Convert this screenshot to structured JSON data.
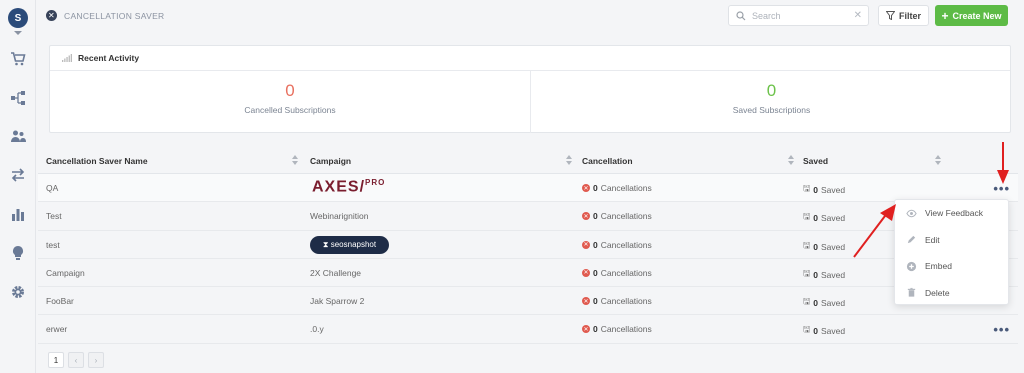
{
  "header": {
    "app_title": "CANCELLATION SAVER",
    "search_placeholder": "Search",
    "filter_label": "Filter",
    "create_label": "Create New"
  },
  "sidebar": {
    "logo_text": "S",
    "items": [
      "cart-icon",
      "flow-icon",
      "users-icon",
      "transfer-icon",
      "chart-icon",
      "bulb-icon",
      "gear-icon"
    ]
  },
  "recent_activity": {
    "title": "Recent Activity",
    "cancelled": {
      "value": "0",
      "label": "Cancelled Subscriptions",
      "color": "#e8705f"
    },
    "saved": {
      "value": "0",
      "label": "Saved Subscriptions",
      "color": "#6cc24a"
    }
  },
  "table": {
    "columns": [
      "Cancellation Saver Name",
      "Campaign",
      "Cancellation",
      "Saved"
    ],
    "rows": [
      {
        "name": "QA",
        "campaign": "",
        "campaign_logo": "AXES/PRO",
        "cancel_count": "0",
        "cancel_label": "Cancellations",
        "saved_count": "0",
        "saved_label": "Saved"
      },
      {
        "name": "Test",
        "campaign": "Webinarignition",
        "cancel_count": "0",
        "cancel_label": "Cancellations",
        "saved_count": "0",
        "saved_label": "Saved"
      },
      {
        "name": "test",
        "campaign": "",
        "campaign_logo": "seosnapshot",
        "cancel_count": "0",
        "cancel_label": "Cancellations",
        "saved_count": "0",
        "saved_label": "Saved"
      },
      {
        "name": "Campaign",
        "campaign": "2X Challenge",
        "cancel_count": "0",
        "cancel_label": "Cancellations",
        "saved_count": "0",
        "saved_label": "Saved"
      },
      {
        "name": "FooBar",
        "campaign": "Jak Sparrow 2",
        "cancel_count": "0",
        "cancel_label": "Cancellations",
        "saved_count": "0",
        "saved_label": "Saved"
      },
      {
        "name": "erwer",
        "campaign": ".0.y",
        "cancel_count": "0",
        "cancel_label": "Cancellations",
        "saved_count": "0",
        "saved_label": "Saved"
      }
    ]
  },
  "context_menu": {
    "items": [
      {
        "label": "View Feedback",
        "icon": "eye-icon"
      },
      {
        "label": "Edit",
        "icon": "pencil-icon"
      },
      {
        "label": "Embed",
        "icon": "plus-circle-icon"
      },
      {
        "label": "Delete",
        "icon": "trash-icon"
      }
    ]
  },
  "pagination": {
    "current": "1",
    "prev": "‹",
    "next": "›"
  },
  "colors": {
    "accent_green": "#5dbb46",
    "danger_red": "#e05a4f",
    "annotation_red": "#e02020"
  }
}
